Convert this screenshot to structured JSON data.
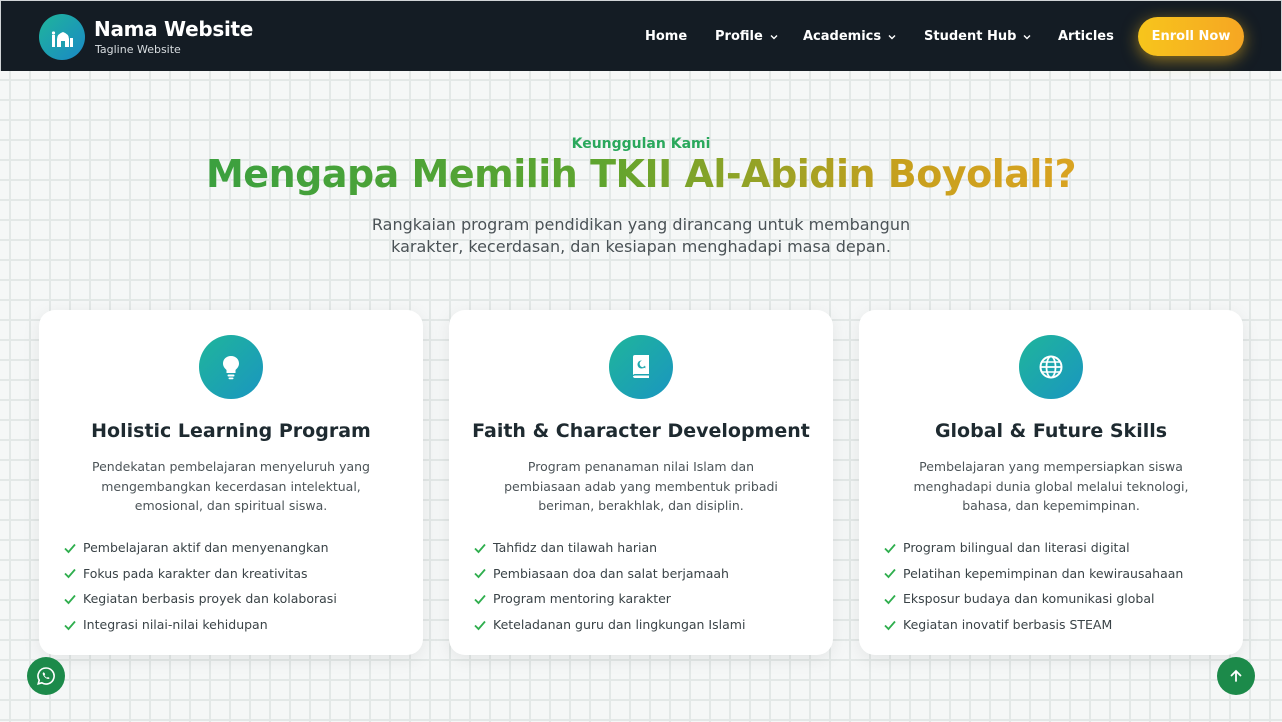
{
  "header": {
    "brand_name": "Nama Website",
    "tagline": "Tagline Website",
    "logo_icon": "mosque-icon",
    "nav": [
      {
        "label": "Home",
        "has_dropdown": false
      },
      {
        "label": "Profile",
        "has_dropdown": true
      },
      {
        "label": "Academics",
        "has_dropdown": true
      },
      {
        "label": "Student Hub",
        "has_dropdown": true
      },
      {
        "label": "Articles",
        "has_dropdown": false
      }
    ],
    "cta_label": "Enroll Now"
  },
  "section": {
    "eyebrow": "Keunggulan Kami",
    "title": "Mengapa Memilih TKII Al-Abidin Boyolali?",
    "subtitle": "Rangkaian program pendidikan yang dirancang untuk membangun karakter, kecerdasan, dan kesiapan menghadapi masa depan."
  },
  "cards": [
    {
      "icon": "lightbulb-icon",
      "title": "Holistic Learning Program",
      "description": "Pendekatan pembelajaran menyeluruh yang mengembangkan kecerdasan intelektual, emosional, dan spiritual siswa.",
      "features": [
        "Pembelajaran aktif dan menyenangkan",
        "Fokus pada karakter dan kreativitas",
        "Kegiatan berbasis proyek dan kolaborasi",
        "Integrasi nilai-nilai kehidupan"
      ]
    },
    {
      "icon": "quran-icon",
      "title": "Faith & Character Development",
      "description": "Program penanaman nilai Islam dan pembiasaan adab yang membentuk pribadi beriman, berakhlak, dan disiplin.",
      "features": [
        "Tahfidz dan tilawah harian",
        "Pembiasaan doa dan salat berjamaah",
        "Program mentoring karakter",
        "Keteladanan guru dan lingkungan Islami"
      ]
    },
    {
      "icon": "globe-icon",
      "title": "Global & Future Skills",
      "description": "Pembelajaran yang mempersiapkan siswa menghadapi dunia global melalui teknologi, bahasa, dan kepemimpinan.",
      "features": [
        "Program bilingual dan literasi digital",
        "Pelatihan kepemimpinan dan kewirausahaan",
        "Eksposur budaya dan komunikasi global",
        "Kegiatan inovatif berbasis STEAM"
      ]
    }
  ],
  "floating": {
    "whatsapp_icon": "whatsapp-icon",
    "back_to_top_icon": "arrow-up-icon"
  },
  "colors": {
    "header_bg": "#141c24",
    "accent_green": "#2aa85c",
    "cta_yellow": "#f7c51c",
    "icon_teal": "#1fb59b",
    "floating_green": "#1c8a4a"
  }
}
